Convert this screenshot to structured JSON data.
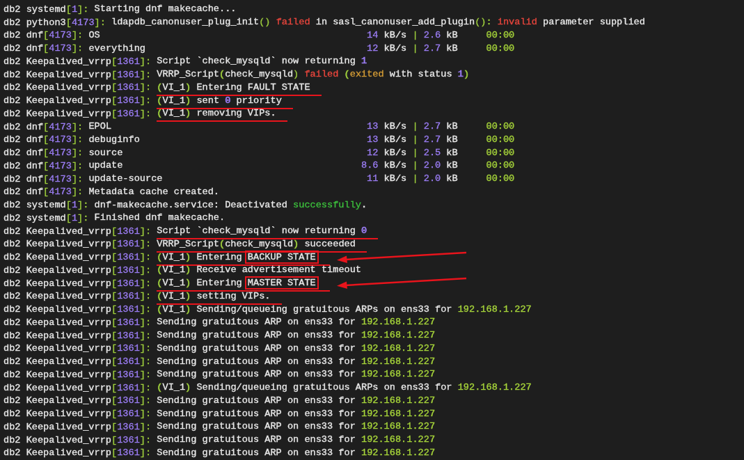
{
  "lines": [
    {
      "kind": "log",
      "source": [
        {
          "t": "db2 systemd",
          "color": "#e8e8e8"
        },
        {
          "t": "[",
          "color": "#9ccc3c"
        },
        {
          "t": "1",
          "color": "#9a7cf2"
        },
        {
          "t": "]:",
          "color": "#9ccc3c"
        }
      ],
      "message": [
        {
          "t": "Starting dnf makecache...",
          "color": "#e8e8e8"
        }
      ],
      "underlined": false,
      "arrow": false
    },
    {
      "kind": "log",
      "source": [
        {
          "t": "db2 python3",
          "color": "#e8e8e8"
        },
        {
          "t": "[",
          "color": "#9ccc3c"
        },
        {
          "t": "4173",
          "color": "#9a7cf2"
        },
        {
          "t": "]:",
          "color": "#9ccc3c"
        }
      ],
      "message": [
        {
          "t": "ldapdb_canonuser_plug_init",
          "color": "#e8e8e8"
        },
        {
          "t": "() ",
          "color": "#9ccc3c"
        },
        {
          "t": "failed",
          "color": "#e8453c"
        },
        {
          "t": " in sasl_canonuser_add_plugin",
          "color": "#e8e8e8"
        },
        {
          "t": "(): ",
          "color": "#9ccc3c"
        },
        {
          "t": "invalid",
          "color": "#e8453c"
        },
        {
          "t": " parameter supplied",
          "color": "#e8e8e8"
        }
      ],
      "underlined": false,
      "arrow": false
    },
    {
      "kind": "repo",
      "source": [
        {
          "t": "db2 dnf",
          "color": "#e8e8e8"
        },
        {
          "t": "[",
          "color": "#9ccc3c"
        },
        {
          "t": "4173",
          "color": "#9a7cf2"
        },
        {
          "t": "]:",
          "color": "#9ccc3c"
        }
      ],
      "repo": {
        "name": "OS",
        "speed": "14",
        "speed_unit": "kB/s",
        "sep": "|",
        "size": "2.6",
        "size_unit": "kB",
        "time": "00:00"
      },
      "underlined": false,
      "arrow": false
    },
    {
      "kind": "repo",
      "source": [
        {
          "t": "db2 dnf",
          "color": "#e8e8e8"
        },
        {
          "t": "[",
          "color": "#9ccc3c"
        },
        {
          "t": "4173",
          "color": "#9a7cf2"
        },
        {
          "t": "]:",
          "color": "#9ccc3c"
        }
      ],
      "repo": {
        "name": "everything",
        "speed": "12",
        "speed_unit": "kB/s",
        "sep": "|",
        "size": "2.7",
        "size_unit": "kB",
        "time": "00:00"
      },
      "underlined": false,
      "arrow": false
    },
    {
      "kind": "log",
      "source": [
        {
          "t": "db2 Keepalived_vrrp",
          "color": "#e8e8e8"
        },
        {
          "t": "[",
          "color": "#9ccc3c"
        },
        {
          "t": "1361",
          "color": "#9a7cf2"
        },
        {
          "t": "]:",
          "color": "#9ccc3c"
        }
      ],
      "message": [
        {
          "t": "Script `check_mysqld` now returning ",
          "color": "#e8e8e8"
        },
        {
          "t": "1",
          "color": "#9a7cf2"
        }
      ],
      "underlined": false,
      "arrow": false
    },
    {
      "kind": "log",
      "source": [
        {
          "t": "db2 Keepalived_vrrp",
          "color": "#e8e8e8"
        },
        {
          "t": "[",
          "color": "#9ccc3c"
        },
        {
          "t": "1361",
          "color": "#9a7cf2"
        },
        {
          "t": "]:",
          "color": "#9ccc3c"
        }
      ],
      "message": [
        {
          "t": "VRRP_Script",
          "color": "#e8e8e8"
        },
        {
          "t": "(",
          "color": "#9ccc3c"
        },
        {
          "t": "check_mysqld",
          "color": "#e8e8e8"
        },
        {
          "t": ") ",
          "color": "#9ccc3c"
        },
        {
          "t": "failed ",
          "color": "#e8453c"
        },
        {
          "t": "(",
          "color": "#9ccc3c"
        },
        {
          "t": "exited",
          "color": "#d49c35"
        },
        {
          "t": " with status ",
          "color": "#e8e8e8"
        },
        {
          "t": "1",
          "color": "#9a7cf2"
        },
        {
          "t": ")",
          "color": "#9ccc3c"
        }
      ],
      "underlined": false,
      "arrow": false
    },
    {
      "kind": "log",
      "source": [
        {
          "t": "db2 Keepalived_vrrp",
          "color": "#e8e8e8"
        },
        {
          "t": "[",
          "color": "#9ccc3c"
        },
        {
          "t": "1361",
          "color": "#9a7cf2"
        },
        {
          "t": "]:",
          "color": "#9ccc3c"
        }
      ],
      "message": [
        {
          "t": "(",
          "color": "#9ccc3c"
        },
        {
          "t": "VI_1",
          "color": "#e8e8e8"
        },
        {
          "t": ")",
          "color": "#9ccc3c"
        },
        {
          "t": " Entering FAULT STATE",
          "color": "#e8e8e8"
        }
      ],
      "underlined": true,
      "arrow": false
    },
    {
      "kind": "log",
      "source": [
        {
          "t": "db2 Keepalived_vrrp",
          "color": "#e8e8e8"
        },
        {
          "t": "[",
          "color": "#9ccc3c"
        },
        {
          "t": "1361",
          "color": "#9a7cf2"
        },
        {
          "t": "]:",
          "color": "#9ccc3c"
        }
      ],
      "message": [
        {
          "t": "(",
          "color": "#9ccc3c"
        },
        {
          "t": "VI_1",
          "color": "#e8e8e8"
        },
        {
          "t": ")",
          "color": "#9ccc3c"
        },
        {
          "t": " sent ",
          "color": "#e8e8e8"
        },
        {
          "t": "0",
          "color": "#9a7cf2"
        },
        {
          "t": " priority",
          "color": "#e8e8e8"
        }
      ],
      "underlined": true,
      "arrow": false
    },
    {
      "kind": "log",
      "source": [
        {
          "t": "db2 Keepalived_vrrp",
          "color": "#e8e8e8"
        },
        {
          "t": "[",
          "color": "#9ccc3c"
        },
        {
          "t": "1361",
          "color": "#9a7cf2"
        },
        {
          "t": "]:",
          "color": "#9ccc3c"
        }
      ],
      "message": [
        {
          "t": "(",
          "color": "#9ccc3c"
        },
        {
          "t": "VI_1",
          "color": "#e8e8e8"
        },
        {
          "t": ")",
          "color": "#9ccc3c"
        },
        {
          "t": " removing VIPs.",
          "color": "#e8e8e8"
        }
      ],
      "underlined": true,
      "arrow": false
    },
    {
      "kind": "repo",
      "source": [
        {
          "t": "db2 dnf",
          "color": "#e8e8e8"
        },
        {
          "t": "[",
          "color": "#9ccc3c"
        },
        {
          "t": "4173",
          "color": "#9a7cf2"
        },
        {
          "t": "]:",
          "color": "#9ccc3c"
        }
      ],
      "repo": {
        "name": "EPOL",
        "speed": "13",
        "speed_unit": "kB/s",
        "sep": "|",
        "size": "2.7",
        "size_unit": "kB",
        "time": "00:00"
      },
      "underlined": false,
      "arrow": false
    },
    {
      "kind": "repo",
      "source": [
        {
          "t": "db2 dnf",
          "color": "#e8e8e8"
        },
        {
          "t": "[",
          "color": "#9ccc3c"
        },
        {
          "t": "4173",
          "color": "#9a7cf2"
        },
        {
          "t": "]:",
          "color": "#9ccc3c"
        }
      ],
      "repo": {
        "name": "debuginfo",
        "speed": "13",
        "speed_unit": "kB/s",
        "sep": "|",
        "size": "2.7",
        "size_unit": "kB",
        "time": "00:00"
      },
      "underlined": false,
      "arrow": false
    },
    {
      "kind": "repo",
      "source": [
        {
          "t": "db2 dnf",
          "color": "#e8e8e8"
        },
        {
          "t": "[",
          "color": "#9ccc3c"
        },
        {
          "t": "4173",
          "color": "#9a7cf2"
        },
        {
          "t": "]:",
          "color": "#9ccc3c"
        }
      ],
      "repo": {
        "name": "source",
        "speed": "12",
        "speed_unit": "kB/s",
        "sep": "|",
        "size": "2.5",
        "size_unit": "kB",
        "time": "00:00"
      },
      "underlined": false,
      "arrow": false
    },
    {
      "kind": "repo",
      "source": [
        {
          "t": "db2 dnf",
          "color": "#e8e8e8"
        },
        {
          "t": "[",
          "color": "#9ccc3c"
        },
        {
          "t": "4173",
          "color": "#9a7cf2"
        },
        {
          "t": "]:",
          "color": "#9ccc3c"
        }
      ],
      "repo": {
        "name": "update",
        "speed": "8.6",
        "speed_unit": "kB/s",
        "sep": "|",
        "size": "2.0",
        "size_unit": "kB",
        "time": "00:00"
      },
      "underlined": false,
      "arrow": false
    },
    {
      "kind": "repo",
      "source": [
        {
          "t": "db2 dnf",
          "color": "#e8e8e8"
        },
        {
          "t": "[",
          "color": "#9ccc3c"
        },
        {
          "t": "4173",
          "color": "#9a7cf2"
        },
        {
          "t": "]:",
          "color": "#9ccc3c"
        }
      ],
      "repo": {
        "name": "update-source",
        "speed": "11",
        "speed_unit": "kB/s",
        "sep": "|",
        "size": "2.0",
        "size_unit": "kB",
        "time": "00:00"
      },
      "underlined": false,
      "arrow": false
    },
    {
      "kind": "log",
      "source": [
        {
          "t": "db2 dnf",
          "color": "#e8e8e8"
        },
        {
          "t": "[",
          "color": "#9ccc3c"
        },
        {
          "t": "4173",
          "color": "#9a7cf2"
        },
        {
          "t": "]:",
          "color": "#9ccc3c"
        }
      ],
      "message": [
        {
          "t": "Metadata cache created.",
          "color": "#e8e8e8"
        }
      ],
      "underlined": false,
      "arrow": false
    },
    {
      "kind": "log",
      "source": [
        {
          "t": "db2 systemd",
          "color": "#e8e8e8"
        },
        {
          "t": "[",
          "color": "#9ccc3c"
        },
        {
          "t": "1",
          "color": "#9a7cf2"
        },
        {
          "t": "]:",
          "color": "#9ccc3c"
        }
      ],
      "message": [
        {
          "t": "dnf-makecache.service: Deactivated ",
          "color": "#e8e8e8"
        },
        {
          "t": "successfully",
          "color": "#3cbf3c"
        },
        {
          "t": ".",
          "color": "#e8e8e8"
        }
      ],
      "underlined": false,
      "arrow": false
    },
    {
      "kind": "log",
      "source": [
        {
          "t": "db2 systemd",
          "color": "#e8e8e8"
        },
        {
          "t": "[",
          "color": "#9ccc3c"
        },
        {
          "t": "1",
          "color": "#9a7cf2"
        },
        {
          "t": "]:",
          "color": "#9ccc3c"
        }
      ],
      "message": [
        {
          "t": "Finished dnf makecache.",
          "color": "#e8e8e8"
        }
      ],
      "underlined": false,
      "arrow": false
    },
    {
      "kind": "log",
      "source": [
        {
          "t": "db2 Keepalived_vrrp",
          "color": "#e8e8e8"
        },
        {
          "t": "[",
          "color": "#9ccc3c"
        },
        {
          "t": "1361",
          "color": "#9a7cf2"
        },
        {
          "t": "]:",
          "color": "#9ccc3c"
        }
      ],
      "message": [
        {
          "t": "Script `check_mysqld` now returning ",
          "color": "#e8e8e8"
        },
        {
          "t": "0",
          "color": "#9a7cf2"
        }
      ],
      "underlined": true,
      "arrow": false
    },
    {
      "kind": "log",
      "source": [
        {
          "t": "db2 Keepalived_vrrp",
          "color": "#e8e8e8"
        },
        {
          "t": "[",
          "color": "#9ccc3c"
        },
        {
          "t": "1361",
          "color": "#9a7cf2"
        },
        {
          "t": "]:",
          "color": "#9ccc3c"
        }
      ],
      "message": [
        {
          "t": "VRRP_Script",
          "color": "#e8e8e8"
        },
        {
          "t": "(",
          "color": "#9ccc3c"
        },
        {
          "t": "check_mysqld",
          "color": "#e8e8e8"
        },
        {
          "t": ")",
          "color": "#9ccc3c"
        },
        {
          "t": " succeeded",
          "color": "#e8e8e8"
        }
      ],
      "underlined": true,
      "arrow": false
    },
    {
      "kind": "log",
      "source": [
        {
          "t": "db2 Keepalived_vrrp",
          "color": "#e8e8e8"
        },
        {
          "t": "[",
          "color": "#9ccc3c"
        },
        {
          "t": "1361",
          "color": "#9a7cf2"
        },
        {
          "t": "]:",
          "color": "#9ccc3c"
        }
      ],
      "message": [
        {
          "t": "(",
          "color": "#9ccc3c"
        },
        {
          "t": "VI_1",
          "color": "#e8e8e8"
        },
        {
          "t": ")",
          "color": "#9ccc3c"
        },
        {
          "t": " Entering ",
          "color": "#e8e8e8"
        }
      ],
      "boxed_text": "BACKUP STATE",
      "underlined": true,
      "arrow": true
    },
    {
      "kind": "log",
      "source": [
        {
          "t": "db2 Keepalived_vrrp",
          "color": "#e8e8e8"
        },
        {
          "t": "[",
          "color": "#9ccc3c"
        },
        {
          "t": "1361",
          "color": "#9a7cf2"
        },
        {
          "t": "]:",
          "color": "#9ccc3c"
        }
      ],
      "message": [
        {
          "t": "(",
          "color": "#9ccc3c"
        },
        {
          "t": "VI_1",
          "color": "#e8e8e8"
        },
        {
          "t": ")",
          "color": "#9ccc3c"
        },
        {
          "t": " Receive advertisement timeout",
          "color": "#e8e8e8"
        }
      ],
      "underlined": false,
      "arrow": false
    },
    {
      "kind": "log",
      "source": [
        {
          "t": "db2 Keepalived_vrrp",
          "color": "#e8e8e8"
        },
        {
          "t": "[",
          "color": "#9ccc3c"
        },
        {
          "t": "1361",
          "color": "#9a7cf2"
        },
        {
          "t": "]:",
          "color": "#9ccc3c"
        }
      ],
      "message": [
        {
          "t": "(",
          "color": "#9ccc3c"
        },
        {
          "t": "VI_1",
          "color": "#e8e8e8"
        },
        {
          "t": ")",
          "color": "#9ccc3c"
        },
        {
          "t": " Entering ",
          "color": "#e8e8e8"
        }
      ],
      "boxed_text": "MASTER STATE",
      "underlined": true,
      "arrow": true
    },
    {
      "kind": "log",
      "source": [
        {
          "t": "db2 Keepalived_vrrp",
          "color": "#e8e8e8"
        },
        {
          "t": "[",
          "color": "#9ccc3c"
        },
        {
          "t": "1361",
          "color": "#9a7cf2"
        },
        {
          "t": "]:",
          "color": "#9ccc3c"
        }
      ],
      "message": [
        {
          "t": "(",
          "color": "#9ccc3c"
        },
        {
          "t": "VI_1",
          "color": "#e8e8e8"
        },
        {
          "t": ")",
          "color": "#9ccc3c"
        },
        {
          "t": " setting VIPs.",
          "color": "#e8e8e8"
        }
      ],
      "underlined": true,
      "arrow": false
    },
    {
      "kind": "log",
      "source": [
        {
          "t": "db2 Keepalived_vrrp",
          "color": "#e8e8e8"
        },
        {
          "t": "[",
          "color": "#9ccc3c"
        },
        {
          "t": "1361",
          "color": "#9a7cf2"
        },
        {
          "t": "]:",
          "color": "#9ccc3c"
        }
      ],
      "message": [
        {
          "t": "(",
          "color": "#9ccc3c"
        },
        {
          "t": "VI_1",
          "color": "#e8e8e8"
        },
        {
          "t": ")",
          "color": "#9ccc3c"
        },
        {
          "t": " Sending/queueing gratuitous ARPs on ens33 for ",
          "color": "#e8e8e8"
        },
        {
          "t": "192.168.1.227",
          "color": "#a6d43a"
        }
      ],
      "underlined": false,
      "arrow": false
    },
    {
      "kind": "log",
      "source": [
        {
          "t": "db2 Keepalived_vrrp",
          "color": "#e8e8e8"
        },
        {
          "t": "[",
          "color": "#9ccc3c"
        },
        {
          "t": "1361",
          "color": "#9a7cf2"
        },
        {
          "t": "]:",
          "color": "#9ccc3c"
        }
      ],
      "message": [
        {
          "t": "Sending gratuitous ARP on ens33 for ",
          "color": "#e8e8e8"
        },
        {
          "t": "192.168.1.227",
          "color": "#a6d43a"
        }
      ],
      "underlined": false,
      "arrow": false
    },
    {
      "kind": "log",
      "source": [
        {
          "t": "db2 Keepalived_vrrp",
          "color": "#e8e8e8"
        },
        {
          "t": "[",
          "color": "#9ccc3c"
        },
        {
          "t": "1361",
          "color": "#9a7cf2"
        },
        {
          "t": "]:",
          "color": "#9ccc3c"
        }
      ],
      "message": [
        {
          "t": "Sending gratuitous ARP on ens33 for ",
          "color": "#e8e8e8"
        },
        {
          "t": "192.168.1.227",
          "color": "#a6d43a"
        }
      ],
      "underlined": false,
      "arrow": false
    },
    {
      "kind": "log",
      "source": [
        {
          "t": "db2 Keepalived_vrrp",
          "color": "#e8e8e8"
        },
        {
          "t": "[",
          "color": "#9ccc3c"
        },
        {
          "t": "1361",
          "color": "#9a7cf2"
        },
        {
          "t": "]:",
          "color": "#9ccc3c"
        }
      ],
      "message": [
        {
          "t": "Sending gratuitous ARP on ens33 for ",
          "color": "#e8e8e8"
        },
        {
          "t": "192.168.1.227",
          "color": "#a6d43a"
        }
      ],
      "underlined": false,
      "arrow": false
    },
    {
      "kind": "log",
      "source": [
        {
          "t": "db2 Keepalived_vrrp",
          "color": "#e8e8e8"
        },
        {
          "t": "[",
          "color": "#9ccc3c"
        },
        {
          "t": "1361",
          "color": "#9a7cf2"
        },
        {
          "t": "]:",
          "color": "#9ccc3c"
        }
      ],
      "message": [
        {
          "t": "Sending gratuitous ARP on ens33 for ",
          "color": "#e8e8e8"
        },
        {
          "t": "192.168.1.227",
          "color": "#a6d43a"
        }
      ],
      "underlined": false,
      "arrow": false
    },
    {
      "kind": "log",
      "source": [
        {
          "t": "db2 Keepalived_vrrp",
          "color": "#e8e8e8"
        },
        {
          "t": "[",
          "color": "#9ccc3c"
        },
        {
          "t": "1361",
          "color": "#9a7cf2"
        },
        {
          "t": "]:",
          "color": "#9ccc3c"
        }
      ],
      "message": [
        {
          "t": "Sending gratuitous ARP on ens33 for ",
          "color": "#e8e8e8"
        },
        {
          "t": "192.168.1.227",
          "color": "#a6d43a"
        }
      ],
      "underlined": false,
      "arrow": false
    },
    {
      "kind": "log",
      "source": [
        {
          "t": "db2 Keepalived_vrrp",
          "color": "#e8e8e8"
        },
        {
          "t": "[",
          "color": "#9ccc3c"
        },
        {
          "t": "1361",
          "color": "#9a7cf2"
        },
        {
          "t": "]:",
          "color": "#9ccc3c"
        }
      ],
      "message": [
        {
          "t": "(",
          "color": "#9ccc3c"
        },
        {
          "t": "VI_1",
          "color": "#e8e8e8"
        },
        {
          "t": ")",
          "color": "#9ccc3c"
        },
        {
          "t": " Sending/queueing gratuitous ARPs on ens33 for ",
          "color": "#e8e8e8"
        },
        {
          "t": "192.168.1.227",
          "color": "#a6d43a"
        }
      ],
      "underlined": false,
      "arrow": false
    },
    {
      "kind": "log",
      "source": [
        {
          "t": "db2 Keepalived_vrrp",
          "color": "#e8e8e8"
        },
        {
          "t": "[",
          "color": "#9ccc3c"
        },
        {
          "t": "1361",
          "color": "#9a7cf2"
        },
        {
          "t": "]:",
          "color": "#9ccc3c"
        }
      ],
      "message": [
        {
          "t": "Sending gratuitous ARP on ens33 for ",
          "color": "#e8e8e8"
        },
        {
          "t": "192.168.1.227",
          "color": "#a6d43a"
        }
      ],
      "underlined": false,
      "arrow": false
    },
    {
      "kind": "log",
      "source": [
        {
          "t": "db2 Keepalived_vrrp",
          "color": "#e8e8e8"
        },
        {
          "t": "[",
          "color": "#9ccc3c"
        },
        {
          "t": "1361",
          "color": "#9a7cf2"
        },
        {
          "t": "]:",
          "color": "#9ccc3c"
        }
      ],
      "message": [
        {
          "t": "Sending gratuitous ARP on ens33 for ",
          "color": "#e8e8e8"
        },
        {
          "t": "192.168.1.227",
          "color": "#a6d43a"
        }
      ],
      "underlined": false,
      "arrow": false
    },
    {
      "kind": "log",
      "source": [
        {
          "t": "db2 Keepalived_vrrp",
          "color": "#e8e8e8"
        },
        {
          "t": "[",
          "color": "#9ccc3c"
        },
        {
          "t": "1361",
          "color": "#9a7cf2"
        },
        {
          "t": "]:",
          "color": "#9ccc3c"
        }
      ],
      "message": [
        {
          "t": "Sending gratuitous ARP on ens33 for ",
          "color": "#e8e8e8"
        },
        {
          "t": "192.168.1.227",
          "color": "#a6d43a"
        }
      ],
      "underlined": false,
      "arrow": false
    },
    {
      "kind": "log",
      "source": [
        {
          "t": "db2 Keepalived_vrrp",
          "color": "#e8e8e8"
        },
        {
          "t": "[",
          "color": "#9ccc3c"
        },
        {
          "t": "1361",
          "color": "#9a7cf2"
        },
        {
          "t": "]:",
          "color": "#9ccc3c"
        }
      ],
      "message": [
        {
          "t": "Sending gratuitous ARP on ens33 for ",
          "color": "#e8e8e8"
        },
        {
          "t": "192.168.1.227",
          "color": "#a6d43a"
        }
      ],
      "underlined": false,
      "arrow": false
    },
    {
      "kind": "log",
      "source": [
        {
          "t": "db2 Keepalived_vrrp",
          "color": "#e8e8e8"
        },
        {
          "t": "[",
          "color": "#9ccc3c"
        },
        {
          "t": "1361",
          "color": "#9a7cf2"
        },
        {
          "t": "]:",
          "color": "#9ccc3c"
        }
      ],
      "message": [
        {
          "t": "Sending gratuitous ARP on ens33 for ",
          "color": "#e8e8e8"
        },
        {
          "t": "192.168.1.227",
          "color": "#a6d43a"
        }
      ],
      "underlined": false,
      "arrow": false
    }
  ]
}
